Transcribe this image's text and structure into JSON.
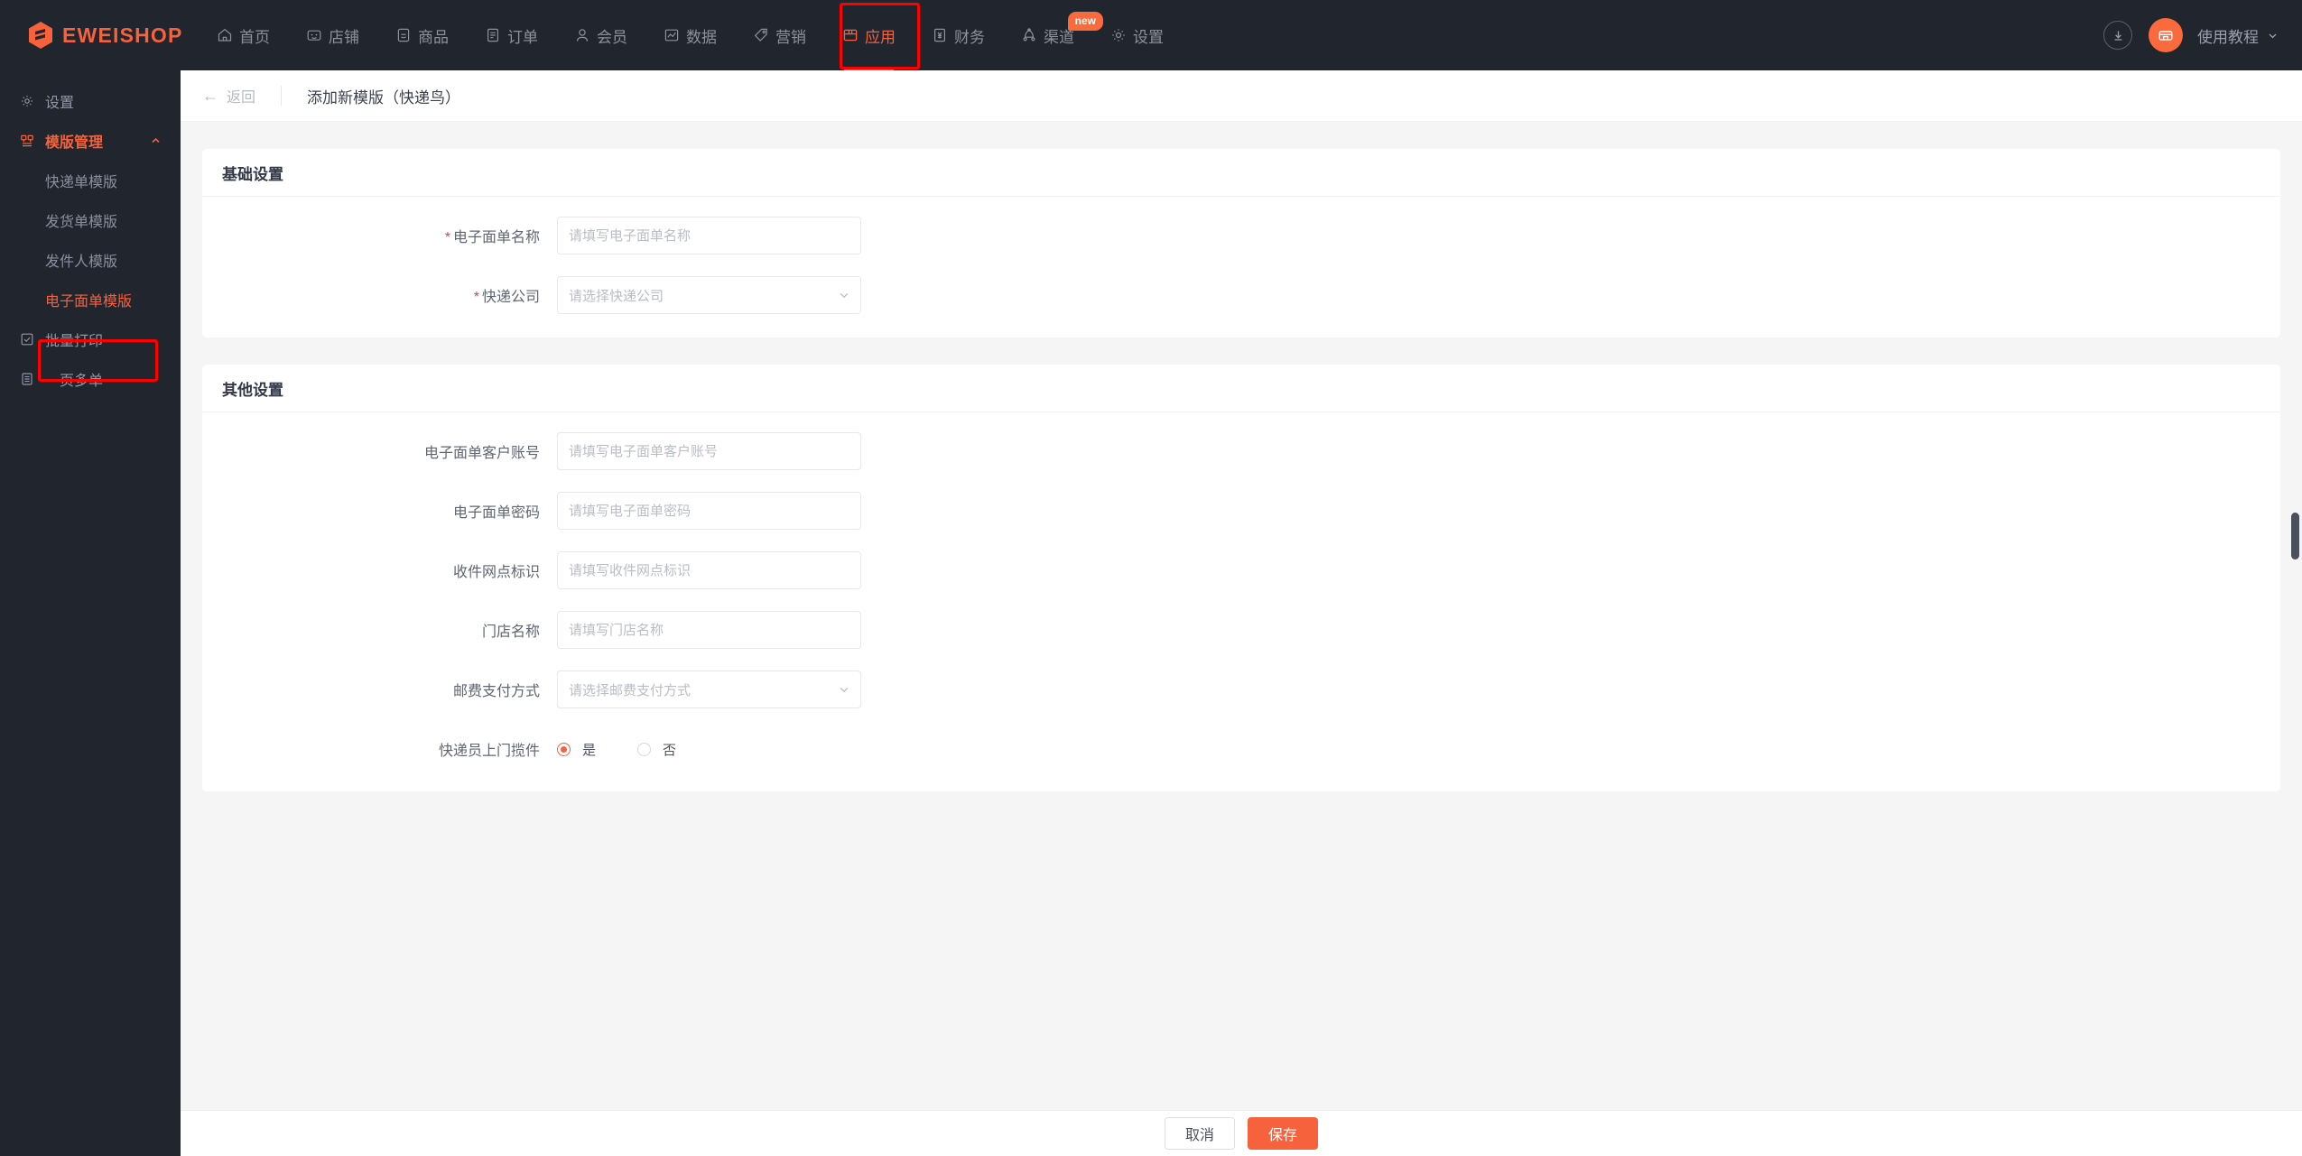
{
  "brand": {
    "name": "EWEISHOP",
    "logo_icon": "hexagon-logo-icon",
    "color": "#f5623c"
  },
  "topnav": {
    "items": [
      {
        "label": "首页",
        "icon": "home-icon",
        "active": false
      },
      {
        "label": "店铺",
        "icon": "shop-icon",
        "active": false
      },
      {
        "label": "商品",
        "icon": "goods-icon",
        "active": false
      },
      {
        "label": "订单",
        "icon": "order-icon",
        "active": false
      },
      {
        "label": "会员",
        "icon": "member-icon",
        "active": false
      },
      {
        "label": "数据",
        "icon": "chart-icon",
        "active": false
      },
      {
        "label": "营销",
        "icon": "tag-icon",
        "active": false
      },
      {
        "label": "应用",
        "icon": "app-box-icon",
        "active": true
      },
      {
        "label": "财务",
        "icon": "finance-icon",
        "active": false
      },
      {
        "label": "渠道",
        "icon": "channel-icon",
        "active": false,
        "badge": "new"
      },
      {
        "label": "设置",
        "icon": "gear-icon",
        "active": false
      }
    ],
    "right": {
      "download_icon": "download-circle-icon",
      "avatar_icon": "shop-avatar-icon",
      "tutorial_label": "使用教程",
      "tutorial_chevron": "chevron-down-icon"
    }
  },
  "sidebar": {
    "items": [
      {
        "label": "设置",
        "icon": "gear-icon",
        "type": "item"
      },
      {
        "label": "模版管理",
        "icon": "template-icon",
        "type": "group",
        "expanded": true,
        "caret": "chevron-up-icon"
      },
      {
        "label": "快递单模版",
        "type": "sub",
        "selected": false
      },
      {
        "label": "发货单模版",
        "type": "sub",
        "selected": false
      },
      {
        "label": "发件人模版",
        "type": "sub",
        "selected": false
      },
      {
        "label": "电子面单模版",
        "type": "sub",
        "selected": true
      },
      {
        "label": "批量打印",
        "icon": "print-icon",
        "type": "item"
      },
      {
        "label": "一页多单",
        "icon": "page-icon",
        "type": "item"
      }
    ]
  },
  "page_head": {
    "back_label": "返回",
    "back_arrow": "arrow-left-icon",
    "title": "添加新模版（快递鸟）"
  },
  "basic_settings": {
    "title": "基础设置",
    "fields": [
      {
        "label": "电子面单名称",
        "required": true,
        "type": "input",
        "value": "",
        "placeholder": "请填写电子面单名称"
      },
      {
        "label": "快递公司",
        "required": true,
        "type": "select",
        "value": "",
        "placeholder": "请选择快递公司"
      }
    ]
  },
  "other_settings": {
    "title": "其他设置",
    "fields": [
      {
        "label": "电子面单客户账号",
        "required": false,
        "type": "input",
        "value": "",
        "placeholder": "请填写电子面单客户账号"
      },
      {
        "label": "电子面单密码",
        "required": false,
        "type": "input",
        "value": "",
        "placeholder": "请填写电子面单密码"
      },
      {
        "label": "收件网点标识",
        "required": false,
        "type": "input",
        "value": "",
        "placeholder": "请填写收件网点标识"
      },
      {
        "label": "门店名称",
        "required": false,
        "type": "input",
        "value": "",
        "placeholder": "请填写门店名称"
      },
      {
        "label": "邮费支付方式",
        "required": false,
        "type": "select",
        "value": "",
        "placeholder": "请选择邮费支付方式"
      }
    ],
    "radio_field": {
      "label": "快递员上门揽件",
      "options": [
        {
          "label": "是",
          "selected": true
        },
        {
          "label": "否",
          "selected": false
        }
      ]
    }
  },
  "footer": {
    "cancel_label": "取消",
    "save_label": "保存"
  },
  "annotations": {
    "nav_highlight_target": "应用",
    "sidebar_highlight_target": "电子面单模版",
    "color": "#ff0000"
  }
}
